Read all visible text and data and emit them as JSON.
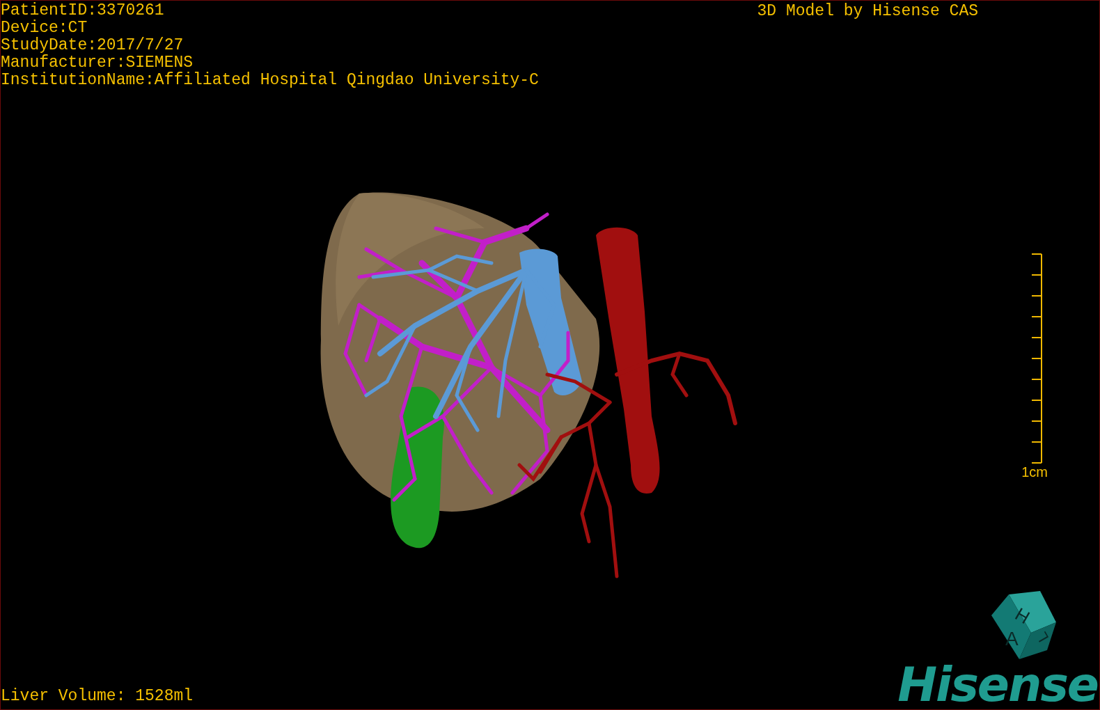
{
  "patient_info": [
    "PatientID:3370261",
    "Device:CT",
    "StudyDate:2017/7/27",
    "Manufacturer:SIEMENS",
    "InstitutionName:Affiliated Hospital Qingdao University-C"
  ],
  "title": "3D Model by Hisense CAS",
  "scale_bar": {
    "label": "1cm"
  },
  "liver_volume": "Liver Volume: 1528ml",
  "orientation_cube": {
    "faces": [
      "H",
      "A",
      "L"
    ]
  },
  "logo": "Hisense"
}
